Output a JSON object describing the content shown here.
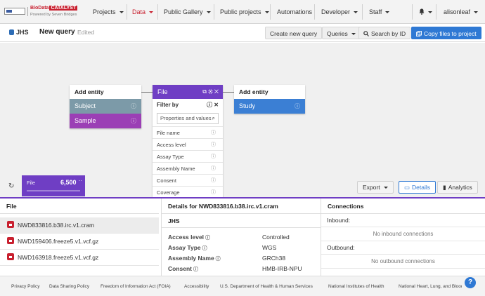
{
  "brand": {
    "name": "BioData",
    "product": "CATALYST",
    "powered_by": "Powered by Seven Bridges"
  },
  "nav": {
    "projects": "Projects",
    "data": "Data",
    "public_gallery": "Public Gallery",
    "public_projects": "Public projects",
    "automations": "Automations",
    "developer": "Developer",
    "staff": "Staff",
    "user": "alisonleaf"
  },
  "query_bar": {
    "dataset": "JHS",
    "title": "New query",
    "status": "Edited",
    "create_new_query": "Create new query",
    "queries": "Queries",
    "search_by_id": "Search by ID",
    "copy_files": "Copy files to project"
  },
  "canvas": {
    "left_card": {
      "header": "Add entity",
      "entities": [
        "Subject",
        "Sample"
      ]
    },
    "file_node": {
      "label": "File",
      "filter_by": "Filter by",
      "search_placeholder": "Properties and values",
      "properties": [
        "File name",
        "Access level",
        "Assay Type",
        "Assembly Name",
        "Consent",
        "Coverage"
      ]
    },
    "right_card": {
      "header": "Add entity",
      "entities": [
        "Study"
      ]
    },
    "mini_node": {
      "label": "File",
      "count": "6,500",
      "more": "··"
    },
    "export": "Export",
    "details_tab": "Details",
    "analytics_tab": "Analytics"
  },
  "files_panel": {
    "header": "File",
    "items": [
      "NWD833816.b38.irc.v1.cram",
      "NWD159406.freeze5.v1.vcf.gz",
      "NWD163918.freeze5.v1.vcf.gz"
    ]
  },
  "details_panel": {
    "header": "Details for  NWD833816.b38.irc.v1.cram",
    "dataset": "JHS",
    "fields": [
      {
        "label": "Access level",
        "value": "Controlled"
      },
      {
        "label": "Assay Type",
        "value": "WGS"
      },
      {
        "label": "Assembly Name",
        "value": "GRCh38"
      },
      {
        "label": "Consent",
        "value": "HMB-IRB-NPU"
      }
    ]
  },
  "connections_panel": {
    "header": "Connections",
    "inbound_label": "Inbound:",
    "inbound_empty": "No inbound connections",
    "outbound_label": "Outbound:",
    "outbound_empty": "No outbound connections"
  },
  "footer": {
    "links": [
      "Privacy Policy",
      "Data Sharing Policy",
      "Freedom of Information Act (FOIA)",
      "Accessibility",
      "U.S. Department of Health & Human Services",
      "National Institutes of Health",
      "National Heart, Lung, and Blood Institute"
    ]
  },
  "colors": {
    "brand_red": "#c8202f",
    "file_purple": "#6f3ec4",
    "subject_gray": "#7c9aa8",
    "sample_purple": "#9b3fb5",
    "study_blue": "#3b7fd4",
    "primary_blue": "#2f79d4"
  },
  "icons": {
    "dataset": "database-icon",
    "search": "search-icon",
    "copy": "copy-icon",
    "bell": "bell-icon",
    "refresh": "refresh-icon",
    "lock": "lock-icon",
    "help": "help-icon"
  }
}
